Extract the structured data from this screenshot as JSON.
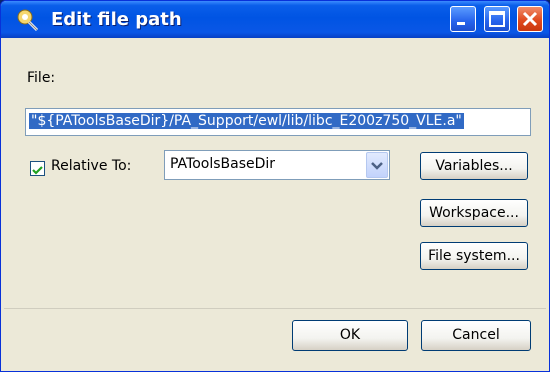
{
  "dialog": {
    "title": "Edit file path",
    "file_label": "File:",
    "file_value": "\"${PAToolsBaseDir}/PA_Support/ewl/lib/libc_E200z750_VLE.a\"",
    "relative_checked": true,
    "relative_label": "Relative To:",
    "relative_value": "PAToolsBaseDir",
    "buttons": {
      "variables": "Variables...",
      "workspace": "Workspace...",
      "file_system": "File system...",
      "ok": "OK",
      "cancel": "Cancel"
    }
  },
  "colors": {
    "titlebar": "#0054e3",
    "window_bg": "#ece9d8",
    "selection": "#316ac5",
    "checkmark": "#21a121"
  },
  "icons": {
    "title": "dialog-app-icon",
    "minimize": "minimize-icon",
    "maximize": "maximize-icon",
    "close": "close-icon",
    "dropdown": "chevron-down-icon",
    "check": "checkmark-icon"
  }
}
